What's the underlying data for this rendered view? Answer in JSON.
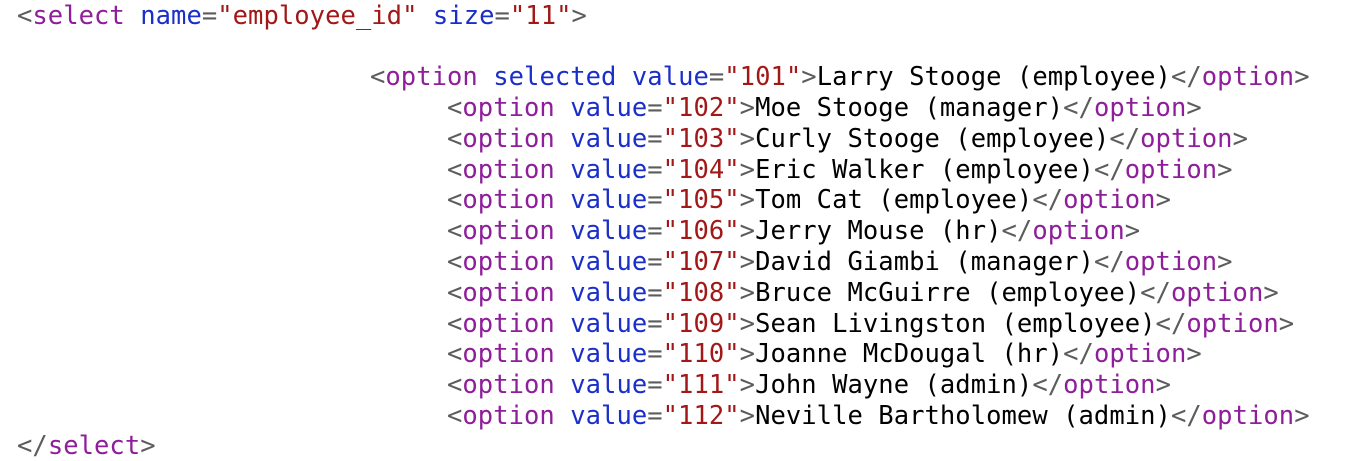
{
  "colors": {
    "punctuation": "#5c5c5c",
    "tag_name": "#8e1e9a",
    "attribute_name": "#1a2ec9",
    "attribute_value": "#a21818",
    "text": "#000000",
    "background": "#ffffff"
  },
  "select_open": {
    "lt": "<",
    "tag": "select",
    "attr1": "name",
    "eq1": "=",
    "val1": "\"employee_id\"",
    "attr2": "size",
    "eq2": "=",
    "val2": "\"11\"",
    "gt": ">"
  },
  "first_option": {
    "lt": "<",
    "tag": "option",
    "attr_selected": "selected",
    "attr_value": "value",
    "eq": "=",
    "value": "\"101\"",
    "gt": ">",
    "text": "Larry Stooge (employee)",
    "close_lt": "</",
    "close_tag": "option",
    "close_gt": ">"
  },
  "options": [
    {
      "value": "\"102\"",
      "text": "Moe Stooge (manager)"
    },
    {
      "value": "\"103\"",
      "text": "Curly Stooge (employee)"
    },
    {
      "value": "\"104\"",
      "text": "Eric Walker (employee)"
    },
    {
      "value": "\"105\"",
      "text": "Tom Cat (employee)"
    },
    {
      "value": "\"106\"",
      "text": "Jerry Mouse (hr)"
    },
    {
      "value": "\"107\"",
      "text": "David Giambi (manager)"
    },
    {
      "value": "\"108\"",
      "text": "Bruce McGuirre (employee)"
    },
    {
      "value": "\"109\"",
      "text": "Sean Livingston (employee)"
    },
    {
      "value": "\"110\"",
      "text": "Joanne McDougal (hr)"
    },
    {
      "value": "\"111\"",
      "text": "John Wayne (admin)"
    },
    {
      "value": "\"112\"",
      "text": "Neville Bartholomew (admin)"
    }
  ],
  "option_syntax": {
    "lt": "<",
    "tag": "option",
    "attr": "value",
    "eq": "=",
    "gt": ">",
    "close_lt": "</",
    "close_tag": "option",
    "close_gt": ">"
  },
  "select_close": {
    "lt": "</",
    "tag": "select",
    "gt": ">"
  }
}
